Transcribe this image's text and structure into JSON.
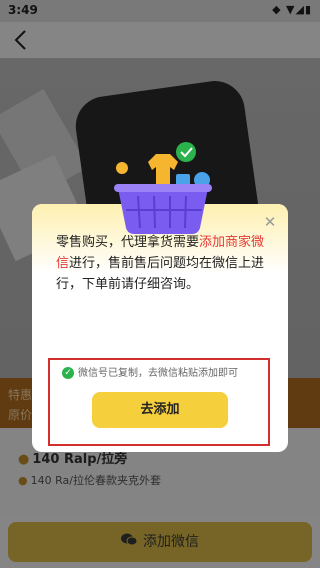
{
  "status_bar": {
    "time": "3:49",
    "icons": "◆ ▼◢▮"
  },
  "nav": {
    "back_icon": "chevron-left"
  },
  "promo": {
    "line1": "特惠",
    "line2": "原价"
  },
  "product": {
    "price_text": "140  Ralp/拉旁",
    "sub_text": "140  Ra/拉伦春款夹克外套"
  },
  "bottom_button": {
    "label": "添加微信",
    "icon": "wechat-icon"
  },
  "modal": {
    "text_before": "零售购买，代理拿货需要",
    "text_highlight": "添加商家微信",
    "text_after": "进行，售前售后问题均在微信上进行，下单前请仔细咨询。",
    "notice": "微信号已复制，去微信粘贴添加即可",
    "button_label": "去添加",
    "close_icon": "close"
  },
  "colors": {
    "highlight": "#e53935",
    "button_yellow": "#f6cf3d",
    "frame_red": "#d32f2f",
    "check_green": "#2bb24c",
    "basket_purple": "#7b5cf0"
  }
}
